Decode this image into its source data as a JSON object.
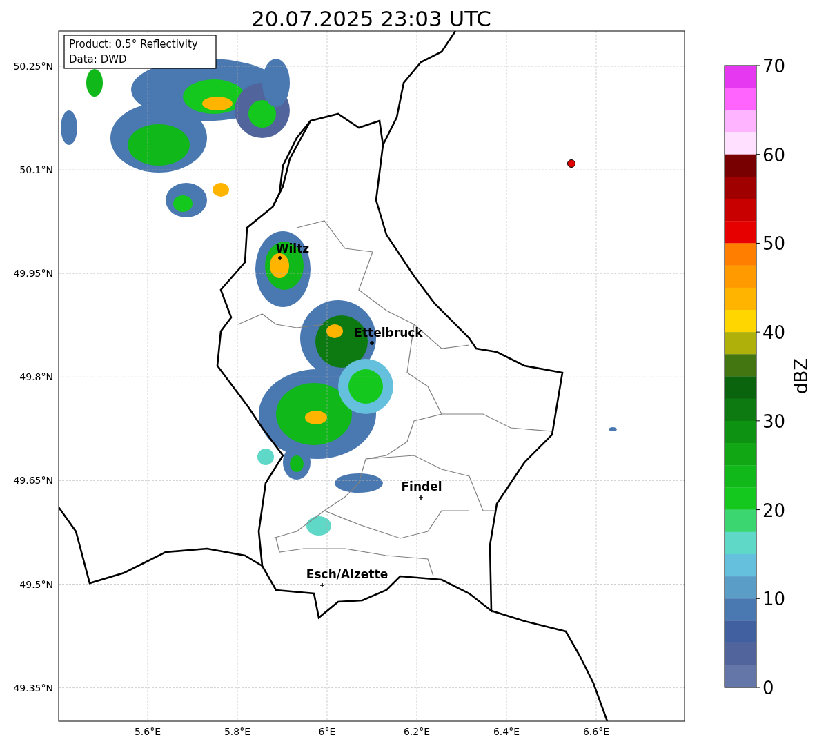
{
  "title": "20.07.2025 23:03 UTC",
  "info_box": {
    "lines": [
      "Product: 0.5° Reflectivity",
      "Data: DWD"
    ]
  },
  "map": {
    "lat_ticks": [
      "50.25°N",
      "50.1°N",
      "49.95°N",
      "49.8°N",
      "49.65°N",
      "49.5°N",
      "49.35°N"
    ],
    "lon_ticks": [
      "5.6°E",
      "5.8°E",
      "6°E",
      "6.2°E",
      "6.4°E",
      "6.6°E"
    ],
    "places": [
      {
        "name": "Wiltz"
      },
      {
        "name": "Ettelbruck"
      },
      {
        "name": "Findel"
      },
      {
        "name": "Esch/Alzette"
      }
    ]
  },
  "colorbar": {
    "label": "dBZ",
    "ticks": [
      "70",
      "60",
      "50",
      "40",
      "30",
      "20",
      "10",
      "0"
    ],
    "bins": [
      {
        "color": "#e638f0"
      },
      {
        "color": "#ff64ff"
      },
      {
        "color": "#ffb4ff"
      },
      {
        "color": "#ffe0ff"
      },
      {
        "color": "#780000"
      },
      {
        "color": "#a00000"
      },
      {
        "color": "#c80000"
      },
      {
        "color": "#e60000"
      },
      {
        "color": "#ff7e00"
      },
      {
        "color": "#ff9a00"
      },
      {
        "color": "#ffb400"
      },
      {
        "color": "#ffd600"
      },
      {
        "color": "#afb00a"
      },
      {
        "color": "#437510"
      },
      {
        "color": "#0a640e"
      },
      {
        "color": "#0c7a10"
      },
      {
        "color": "#0e9212"
      },
      {
        "color": "#10a614"
      },
      {
        "color": "#11b81a"
      },
      {
        "color": "#14c81e"
      },
      {
        "color": "#3cd670"
      },
      {
        "color": "#5fd8c8"
      },
      {
        "color": "#64c0dc"
      },
      {
        "color": "#5a9ec8"
      },
      {
        "color": "#4a78b0"
      },
      {
        "color": "#4160a0"
      },
      {
        "color": "#51649c"
      },
      {
        "color": "#6475a8"
      }
    ]
  }
}
